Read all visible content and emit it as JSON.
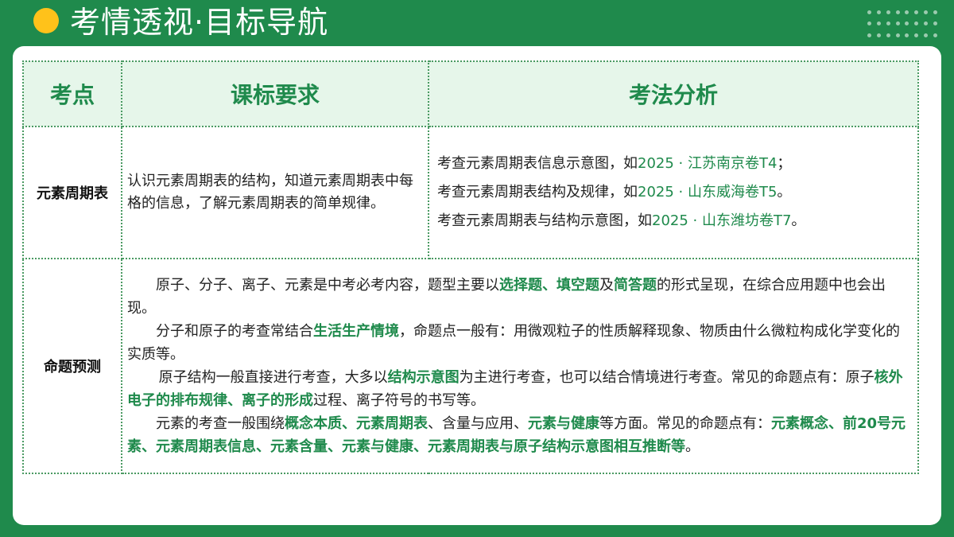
{
  "header": {
    "title": "考情透视·目标导航"
  },
  "table": {
    "columns": [
      "考点",
      "课标要求",
      "考法分析"
    ],
    "row1": {
      "label": "元素周期表",
      "requirement": "认识元素周期表的结构，知道元素周期表中每格的信息，了解元素周期表的简单规律。",
      "analysis": [
        {
          "text": "考查元素周期表信息示意图，如",
          "source": "2025 · 江苏南京卷T4",
          "end": "；"
        },
        {
          "text": "考查元素周期表结构及规律，如",
          "source": "2025 · 山东威海卷T5",
          "end": "。"
        },
        {
          "text": "考查元素周期表与结构示意图，如",
          "source": "2025 · 山东潍坊卷T7",
          "end": "。"
        }
      ]
    },
    "row2": {
      "label": "命题预测",
      "p1": {
        "a": "原子、分子、离子、元素是中考必考内容，题型主要以",
        "k1": "选择题",
        "b": "、",
        "k2": "填空题",
        "c": "及",
        "k3": "简答题",
        "d": "的形式呈现，在综合应用题中也会出现。"
      },
      "p2": {
        "a": "分子和原子的考查常结合",
        "k1": "生活生产情境",
        "b": "，命题点一般有：用微观粒子的性质解释现象、物质由什么微粒构成化学变化的实质等。"
      },
      "p3": {
        "a": "原子结构一般直接进行考查，大多以",
        "k1": "结构示意图",
        "b": "为主进行考查，也可以结合情境进行考查。常见的命题点有：原子",
        "k2": "核外电子的排布规律、离子的形成",
        "c": "过程、离子符号的书写等。"
      },
      "p4": {
        "a": "元素的考查一般围绕",
        "k1": "概念本质、元素周期表",
        "b": "、含量与应用、",
        "k2": "元素与健康",
        "c": "等方面。常见的命题点有：",
        "k3": "元素概念、前20号元素、元素周期表信息、元素含量、元素与健康、元素周期表与原子结构示意图相互推断等",
        "d": "。"
      }
    }
  },
  "colors": {
    "brand_green": "#1f8a4c",
    "accent_yellow": "#ffc21a",
    "header_bg": "#e6f6ea"
  }
}
